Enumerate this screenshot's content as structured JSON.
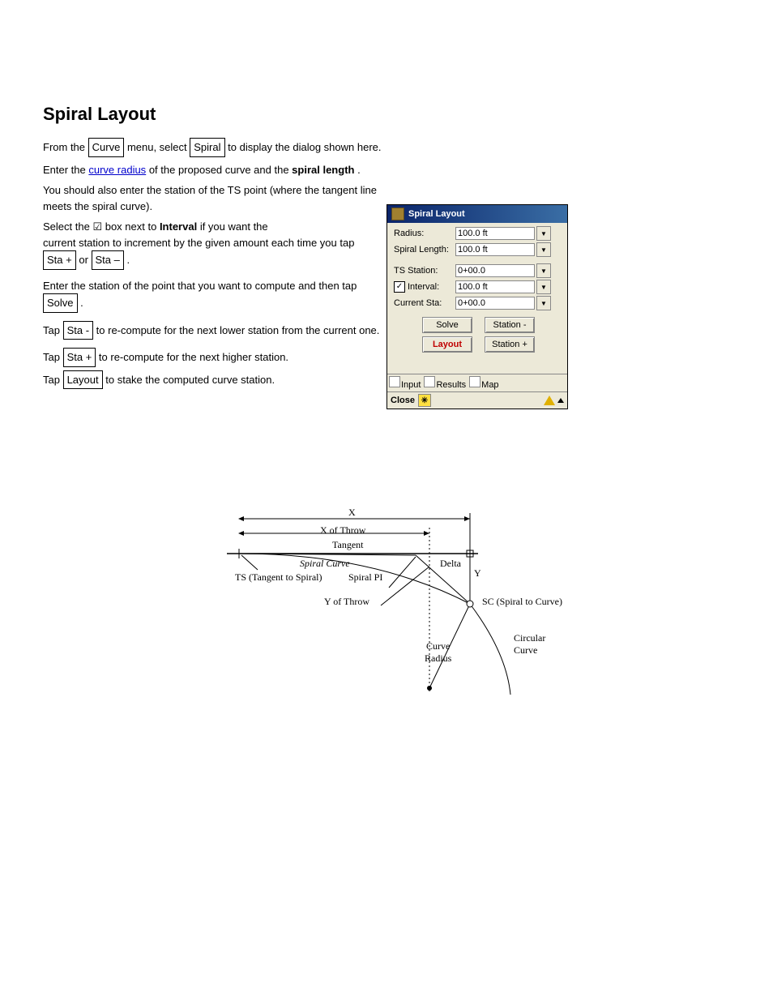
{
  "heading": "Spiral Layout",
  "intro": {
    "l1_prefix": "From the ",
    "l1_curve_box": "Curve",
    "l1_mid": " menu, select ",
    "l1_spiral_box": "Spiral",
    "l1_end": " to display the dialog shown here.",
    "l2_prefix": "Enter the ",
    "l2_link": "curve radius",
    "l2_mid": " of the proposed curve and the ",
    "l2_bold": "spiral length",
    "l2_end": ".",
    "l3": "You should also enter the station of the TS point (where the tangent line meets the spiral curve).",
    "l4_prefix": "Select the ",
    "l4_check": "☑",
    "l4_mid": " box next to ",
    "l4_bold": "Interval",
    "l4_end": " if you want the",
    "l5_prefix": "current station to increment by the given amount each time you tap ",
    "l5_box1": "Sta +",
    "l5_mid": " or ",
    "l5_box2": "Sta –",
    "l5_end": ".",
    "l6_prefix": "Enter the station of the point that you want to compute and then tap ",
    "l6_box": "Solve",
    "l6_end": ".",
    "l7_prefix": "Tap ",
    "l7_box": "Sta -",
    "l7_end": " to re-compute for the next lower station from the current one.",
    "l8_prefix": "Tap ",
    "l8_box": "Sta +",
    "l8_end": " to re-compute for the next higher station.",
    "l9_prefix": "Tap ",
    "l9_box": "Layout",
    "l9_end": " to stake the computed curve station."
  },
  "dialog": {
    "title": "Spiral Layout",
    "radius_label": "Radius:",
    "radius_value": "100.0 ft",
    "spiral_length_label": "Spiral Length:",
    "spiral_length_value": "100.0 ft",
    "ts_station_label": "TS Station:",
    "ts_station_value": "0+00.0",
    "interval_label": "Interval:",
    "interval_value": "100.0 ft",
    "current_sta_label": "Current Sta:",
    "current_sta_value": "0+00.0",
    "solve_btn": "Solve",
    "station_minus_btn": "Station -",
    "layout_btn": "Layout",
    "station_plus_btn": "Station +",
    "tab_input": "Input",
    "tab_results": "Results",
    "tab_map": "Map",
    "close": "Close"
  },
  "diagram": {
    "x": "X",
    "x_of_throw": "X of Throw",
    "tangent": "Tangent",
    "spiral_curve": "Spiral Curve",
    "ts": "TS (Tangent to Spiral)",
    "spiral_pi": "Spiral PI",
    "y_of_throw": "Y of Throw",
    "delta": "Delta",
    "y": "Y",
    "sc": "SC (Spiral to Curve)",
    "curve_radius": "Curve\nRadius",
    "circular_curve": "Circular\nCurve"
  }
}
